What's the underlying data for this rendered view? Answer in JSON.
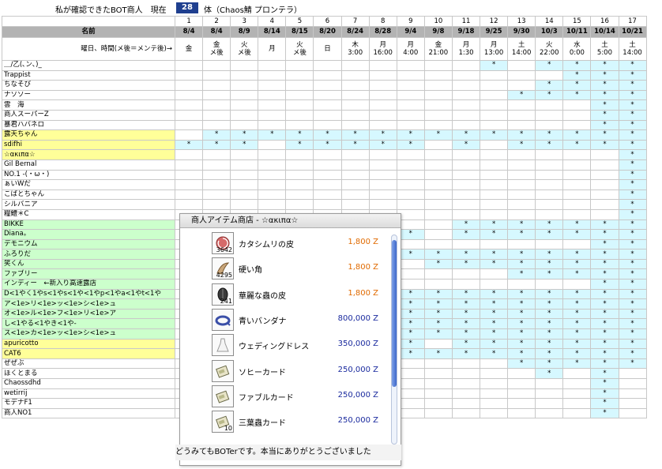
{
  "title": {
    "prefix": "私が確認できたBOT商人　現在",
    "count": "28",
    "suffix": "体（Chaos鯖 プロンテラ）"
  },
  "header": {
    "name_label": "名前",
    "day_label": "曜日、時間(メ後＝メンテ後)→",
    "nums": [
      "1",
      "2",
      "3",
      "4",
      "5",
      "6",
      "7",
      "8",
      "9",
      "10",
      "11",
      "12",
      "13",
      "14",
      "15",
      "16",
      "17"
    ],
    "dates": [
      "8/4",
      "8/4",
      "8/9",
      "8/14",
      "8/15",
      "8/20",
      "8/24",
      "8/28",
      "9/4",
      "9/8",
      "9/18",
      "9/25",
      "9/30",
      "10/3",
      "10/11",
      "10/14",
      "10/21"
    ],
    "days": [
      [
        "金",
        ""
      ],
      [
        "金",
        "メ後"
      ],
      [
        "火",
        "メ後"
      ],
      [
        "月",
        ""
      ],
      [
        "火",
        "メ後"
      ],
      [
        "日",
        ""
      ],
      [
        "木",
        "3:00"
      ],
      [
        "月",
        "16:00"
      ],
      [
        "月",
        "4:00"
      ],
      [
        "金",
        "21:00"
      ],
      [
        "月",
        "1:30"
      ],
      [
        "月",
        "13:00"
      ],
      [
        "土",
        "14:00"
      ],
      [
        "火",
        "22:00"
      ],
      [
        "水",
        "0:00"
      ],
      [
        "土",
        "5:00"
      ],
      [
        "土",
        "14:00"
      ]
    ]
  },
  "rows": [
    {
      "name": "＿/乙(､ン､)_",
      "color": "",
      "marks": [
        12,
        14,
        15,
        16,
        17
      ]
    },
    {
      "name": "Trappist",
      "color": "",
      "marks": [
        15,
        16,
        17
      ]
    },
    {
      "name": "ちなそび",
      "color": "",
      "marks": [
        14,
        15,
        16,
        17
      ]
    },
    {
      "name": "ナソソー",
      "color": "",
      "marks": [
        13,
        14,
        15,
        16,
        17
      ]
    },
    {
      "name": "雲　海",
      "color": "",
      "marks": [
        16,
        17
      ]
    },
    {
      "name": "商人スーパーZ",
      "color": "",
      "marks": [
        16,
        17
      ]
    },
    {
      "name": "暴君ハバネロ",
      "color": "",
      "marks": [
        16,
        17
      ]
    },
    {
      "name": "露天ちゃん",
      "color": "yellow",
      "marks": [
        2,
        3,
        4,
        5,
        6,
        7,
        8,
        9,
        10,
        11,
        12,
        13,
        14,
        15,
        16,
        17
      ]
    },
    {
      "name": "sdifhi",
      "color": "yellow",
      "marks": [
        1,
        2,
        3,
        5,
        6,
        7,
        8,
        9,
        11,
        13,
        14,
        15,
        16,
        17
      ]
    },
    {
      "name": "☆ακιπα☆",
      "color": "yellow",
      "marks": [
        17
      ]
    },
    {
      "name": "Gil Bernal",
      "color": "",
      "marks": [
        17
      ]
    },
    {
      "name": "NO.1 -(・ω・)",
      "color": "",
      "marks": [
        17
      ]
    },
    {
      "name": "ぁいWだ",
      "color": "",
      "marks": [
        17
      ]
    },
    {
      "name": "こばとちゃん",
      "color": "",
      "marks": [
        17
      ]
    },
    {
      "name": "シルバニア",
      "color": "",
      "marks": [
        17
      ]
    },
    {
      "name": "糧鱧＊C",
      "color": "",
      "marks": [
        17
      ]
    },
    {
      "name": "BIKKE",
      "color": "green",
      "marks": [
        11,
        12,
        13,
        14,
        15,
        16,
        17
      ]
    },
    {
      "name": "Diana。",
      "color": "green",
      "marks": [
        9,
        11,
        12,
        13,
        14,
        15,
        16,
        17
      ]
    },
    {
      "name": "デモニウム",
      "color": "green",
      "marks": [
        16,
        17
      ]
    },
    {
      "name": "ふろりだ",
      "color": "green",
      "marks": [
        9,
        10,
        11,
        12,
        13,
        14,
        15,
        16,
        17
      ]
    },
    {
      "name": "笑くん",
      "color": "green",
      "marks": [
        10,
        11,
        12,
        13,
        14,
        15,
        16,
        17
      ]
    },
    {
      "name": "ファブリー",
      "color": "green",
      "marks": [
        13,
        14,
        15,
        16,
        17
      ]
    },
    {
      "name": "インディー　←新入り高速露店",
      "color": "green",
      "marks": [
        16,
        17
      ]
    },
    {
      "name": "D<1やく1やs<1やs<1や<1やp<1やa<1やt<1や",
      "color": "green",
      "marks": [
        9,
        10,
        11,
        12,
        13,
        14,
        15,
        16,
        17
      ]
    },
    {
      "name": "ア<1e>リ<1e>ッ<1e>シ<1e>ュ",
      "color": "green",
      "marks": [
        9,
        10,
        11,
        12,
        13,
        14,
        15,
        16,
        17
      ]
    },
    {
      "name": "オ<1e>ル<1e>フ<1e>リ<1e>ア",
      "color": "green",
      "marks": [
        9,
        10,
        11,
        12,
        13,
        14,
        15,
        16,
        17
      ]
    },
    {
      "name": "し<1やる<1やき<1や-",
      "color": "green",
      "marks": [
        9,
        10,
        11,
        12,
        13,
        14,
        15,
        16,
        17
      ]
    },
    {
      "name": "ス<1e>カ<1e>ッ<1e>シ<1e>ュ",
      "color": "green",
      "marks": [
        9,
        10,
        11,
        12,
        13,
        14,
        15,
        16,
        17
      ]
    },
    {
      "name": "apuricotto",
      "color": "yellow",
      "marks": [
        9,
        11,
        12,
        13,
        14,
        15,
        16,
        17
      ]
    },
    {
      "name": "CAT6",
      "color": "yellow",
      "marks": [
        9,
        10,
        11,
        12,
        13,
        14,
        15,
        16,
        17
      ]
    },
    {
      "name": "ぜぜぶ",
      "color": "",
      "marks": [
        13,
        14,
        15,
        16,
        17
      ]
    },
    {
      "name": "ほくとまる",
      "color": "",
      "marks": [
        14,
        16
      ]
    },
    {
      "name": "Chaossdhd",
      "color": "",
      "marks": [
        16
      ]
    },
    {
      "name": "wetirrij",
      "color": "",
      "marks": [
        16
      ]
    },
    {
      "name": "モデナF1",
      "color": "",
      "marks": [
        16
      ]
    },
    {
      "name": "商人NO1",
      "color": "",
      "marks": [
        16
      ]
    }
  ],
  "mark_symbol": "*",
  "colors": {
    "mark_bg": "#d6f8ff",
    "yellow": "#ffff99",
    "green": "#ccffcc",
    "header_bg": "#b3b3b3"
  },
  "shop": {
    "title": "商人アイテム商店 - ☆ακιπα☆",
    "items": [
      {
        "icon": "snail-shell-icon",
        "qty": "3642",
        "name": "カタシムリの皮",
        "price": "1,800 Z",
        "price_color": "orange"
      },
      {
        "icon": "horn-icon",
        "qty": "4295",
        "name": "硬い角",
        "price": "1,800 Z",
        "price_color": "orange"
      },
      {
        "icon": "insect-skin-icon",
        "qty": "241",
        "name": "華麗な蟲の皮",
        "price": "1,800 Z",
        "price_color": "orange"
      },
      {
        "icon": "bandana-icon",
        "qty": "",
        "name": "青いバンダナ",
        "price": "800,000 Z",
        "price_color": "blue"
      },
      {
        "icon": "wedding-dress-icon",
        "qty": "",
        "name": "ウェディングドレス",
        "price": "350,000 Z",
        "price_color": "blue"
      },
      {
        "icon": "card-icon",
        "qty": "",
        "name": "ソヒーカード",
        "price": "250,000 Z",
        "price_color": "blue"
      },
      {
        "icon": "card-icon",
        "qty": "",
        "name": "ファブルカード",
        "price": "250,000 Z",
        "price_color": "blue"
      },
      {
        "icon": "card-icon",
        "qty": "10",
        "name": "三葉蟲カード",
        "price": "250,000 Z",
        "price_color": "blue"
      }
    ],
    "footer": "どうみてもBOTerです。本当にありがとうございました"
  }
}
